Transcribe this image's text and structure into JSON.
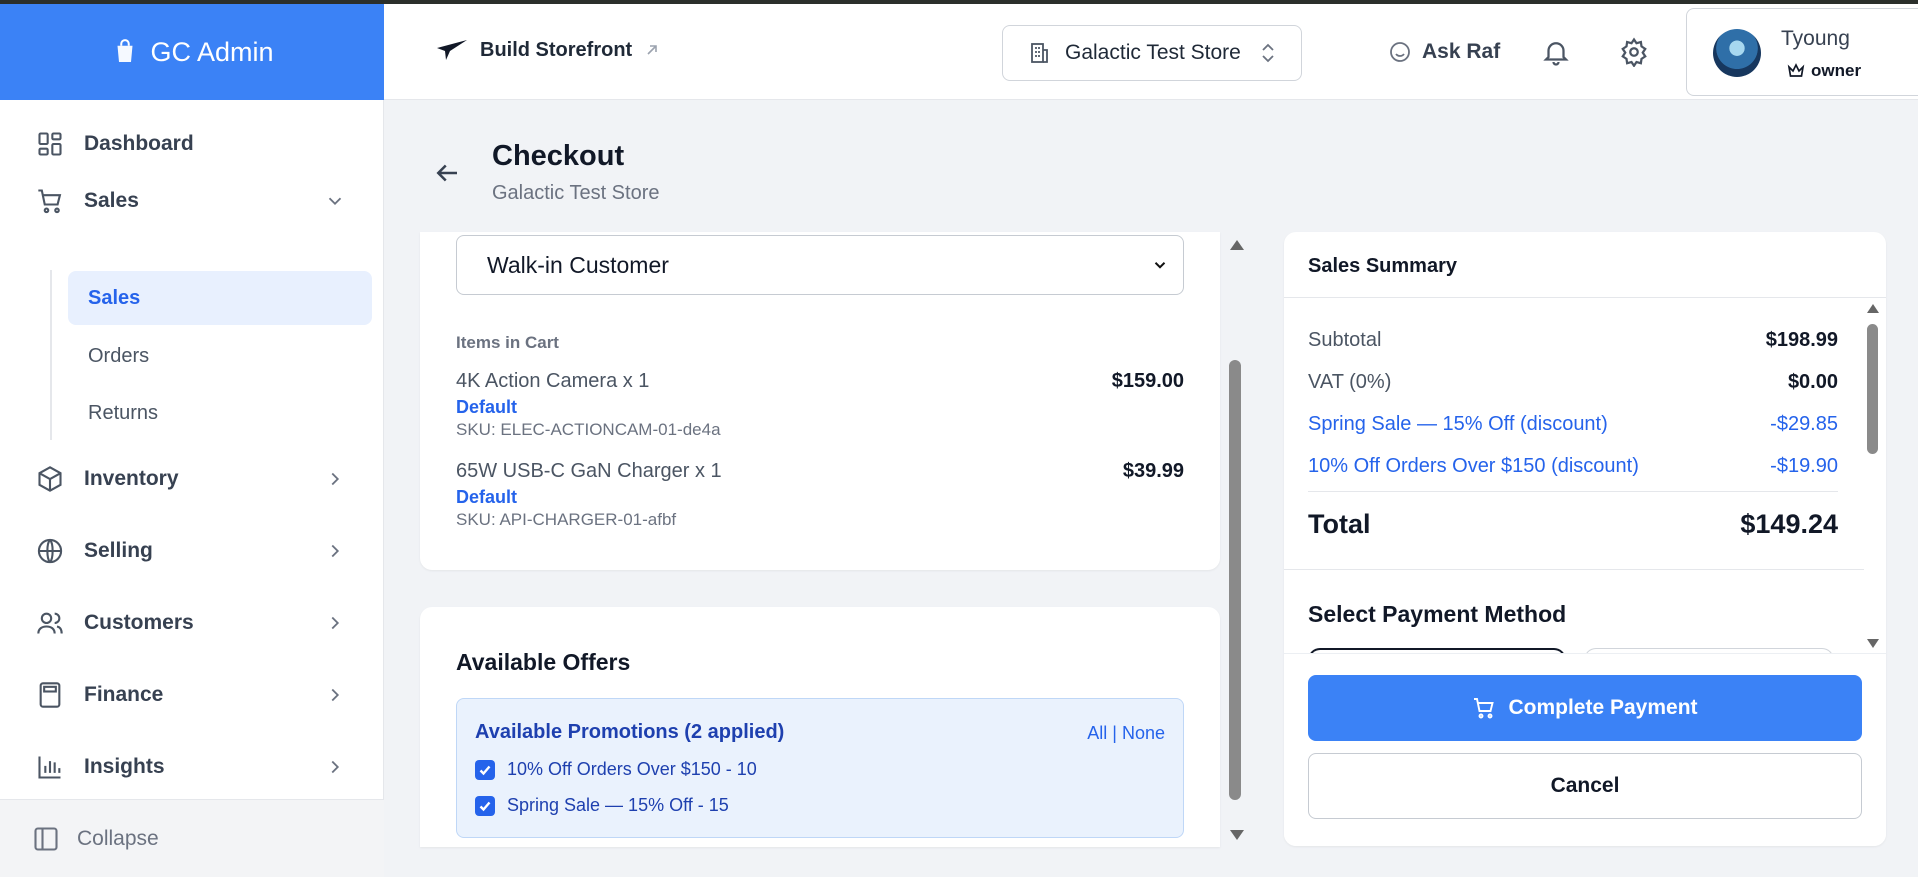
{
  "app": {
    "brand": "GC Admin"
  },
  "sidebar": {
    "items": [
      {
        "label": "Dashboard",
        "icon": "dashboard-icon"
      },
      {
        "label": "Sales",
        "icon": "cart-icon",
        "expanded": true
      },
      {
        "label": "Inventory",
        "icon": "box-icon"
      },
      {
        "label": "Selling",
        "icon": "globe-icon"
      },
      {
        "label": "Customers",
        "icon": "users-icon"
      },
      {
        "label": "Finance",
        "icon": "calculator-icon"
      },
      {
        "label": "Insights",
        "icon": "bar-chart-icon"
      }
    ],
    "sales_sub": [
      {
        "label": "Sales",
        "active": true
      },
      {
        "label": "Orders"
      },
      {
        "label": "Returns"
      }
    ],
    "collapse_label": "Collapse"
  },
  "header": {
    "build_storefront": "Build Storefront",
    "store_name": "Galactic Test Store",
    "ask_raf": "Ask Raf",
    "user": {
      "name": "Tyoung",
      "role": "owner"
    }
  },
  "page": {
    "title": "Checkout",
    "subtitle": "Galactic Test Store"
  },
  "customer": {
    "selected": "Walk-in Customer"
  },
  "cart": {
    "heading": "Items in Cart",
    "items": [
      {
        "name": "4K Action Camera x 1",
        "price": "$159.00",
        "variant": "Default",
        "sku": "SKU: ELEC-ACTIONCAM-01-de4a"
      },
      {
        "name": "65W USB-C GaN Charger x 1",
        "price": "$39.99",
        "variant": "Default",
        "sku": "SKU: API-CHARGER-01-afbf"
      }
    ]
  },
  "offers": {
    "title": "Available Offers",
    "promotions_title": "Available Promotions (2 applied)",
    "all_label": "All",
    "separator": "|",
    "none_label": "None",
    "promotions": [
      {
        "label": "10% Off Orders Over $150 - 10",
        "checked": true
      },
      {
        "label": "Spring Sale — 15% Off - 15",
        "checked": true
      }
    ]
  },
  "summary": {
    "title": "Sales Summary",
    "subtotal_label": "Subtotal",
    "subtotal": "$198.99",
    "vat_label": "VAT (0%)",
    "vat": "$0.00",
    "discounts": [
      {
        "label": "Spring Sale — 15% Off (discount)",
        "amount": "-$29.85"
      },
      {
        "label": "10% Off Orders Over $150 (discount)",
        "amount": "-$19.90"
      }
    ],
    "total_label": "Total",
    "total": "$149.24",
    "payment_title": "Select Payment Method",
    "complete_label": "Complete Payment",
    "cancel_label": "Cancel"
  },
  "colors": {
    "primary": "#3b82f6",
    "link": "#2563eb",
    "promo_bg": "#eaf2fd"
  }
}
